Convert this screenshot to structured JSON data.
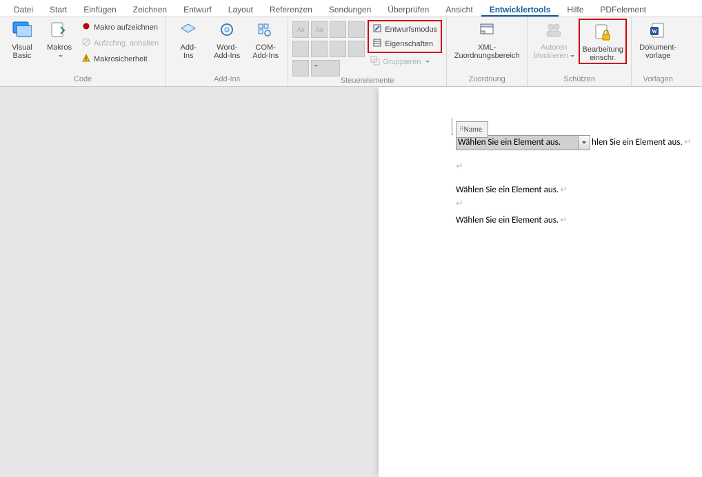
{
  "tabs": {
    "file": "Datei",
    "home": "Start",
    "insert": "Einfügen",
    "draw": "Zeichnen",
    "design": "Entwurf",
    "layout": "Layout",
    "references": "Referenzen",
    "mailings": "Sendungen",
    "review": "Überprüfen",
    "view": "Ansicht",
    "developer": "Entwicklertools",
    "help": "Hilfe",
    "pdfelement": "PDFelement"
  },
  "ribbon": {
    "code": {
      "visual_basic": "Visual\nBasic",
      "macros": "Makros",
      "record_macro": "Makro aufzeichnen",
      "pause_recording": "Aufzchng. anhalten",
      "macro_security": "Makrosicherheit",
      "label": "Code"
    },
    "addins": {
      "addins": "Add-\nIns",
      "word_addins": "Word-\nAdd-Ins",
      "com_addins": "COM-\nAdd-Ins",
      "label": "Add-Ins"
    },
    "controls": {
      "design_mode": "Entwurfsmodus",
      "properties": "Eigenschaften",
      "group": "Gruppieren",
      "label": "Steuerelemente"
    },
    "mapping": {
      "xml_mapping": "XML-\nZuordnungsbereich",
      "label": "Zuordnung"
    },
    "protect": {
      "block_authors": "Autoren\nblockieren",
      "restrict_editing": "Bearbeitung\neinschr.",
      "label": "Schützen"
    },
    "templates": {
      "doc_template": "Dokument-\nvorlage",
      "label": "Vorlagen"
    }
  },
  "document": {
    "cc_title": "Name",
    "cc_value_full": "Wählen Sie ein Element aus.",
    "trailing_fragment": "hlen Sie ein Element aus.",
    "line2": "Wählen Sie ein Element aus.",
    "line3": "Wählen Sie ein Element aus.",
    "para_mark": "↵"
  }
}
